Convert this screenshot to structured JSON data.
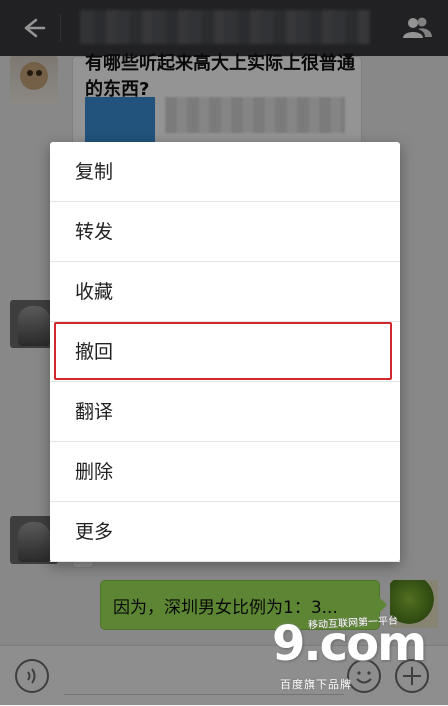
{
  "chat": {
    "article_title": "有哪些听起来高大上实际上很普通的东西?",
    "last_message": "因为，深圳男女比例为1：3..."
  },
  "context_menu": {
    "items": [
      {
        "label": "复制"
      },
      {
        "label": "转发"
      },
      {
        "label": "收藏"
      },
      {
        "label": "撤回"
      },
      {
        "label": "翻译"
      },
      {
        "label": "删除"
      },
      {
        "label": "更多"
      }
    ],
    "highlighted_item": "撤回",
    "highlight_color": "#d0282e"
  },
  "watermark": {
    "logo": "9.com",
    "tagline": "移动互联网第一平台",
    "subtitle": "百度旗下品牌"
  },
  "colors": {
    "topbar": "#393a3f",
    "sent_bubble": "#a0e75a"
  },
  "icons": {
    "topbar_left": "back-arrow-icon",
    "topbar_right": "group-members-icon",
    "bottom_left": "voice-icon",
    "bottom_right": "plus-icon"
  }
}
